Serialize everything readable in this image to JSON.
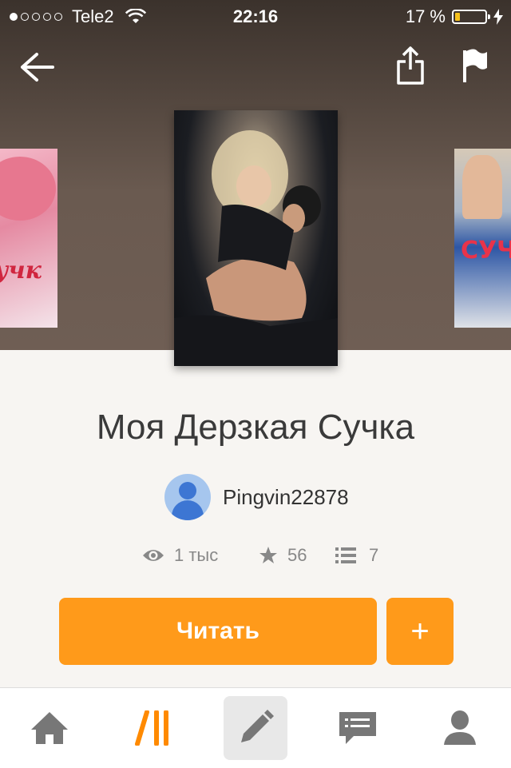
{
  "status_bar": {
    "carrier": "Tele2",
    "time": "22:16",
    "battery": "17 %",
    "battery_level": 0.17,
    "signal_dots_filled": 1
  },
  "toolbar": {
    "back_icon": "arrow-left-icon",
    "share_icon": "share-icon",
    "flag_icon": "flag-icon"
  },
  "carousel": {
    "left_cover_text": "я сучк",
    "right_cover_text": "СУЧ"
  },
  "story": {
    "title": "Моя Дерзкая Сучка",
    "author": "Pingvin22878"
  },
  "stats": {
    "views": "1 тыс",
    "votes": "56",
    "parts": "7"
  },
  "actions": {
    "read_label": "Читать",
    "add_label": "+"
  },
  "colors": {
    "accent": "#ff9a1a",
    "battery": "#f5c11d",
    "avatar": "#3d76d3"
  },
  "tabbar": {
    "items": [
      {
        "name": "home",
        "icon": "home-icon"
      },
      {
        "name": "browse",
        "icon": "wattpad-logo-icon"
      },
      {
        "name": "write",
        "icon": "pencil-icon",
        "active": true
      },
      {
        "name": "messages",
        "icon": "chat-icon"
      },
      {
        "name": "profile",
        "icon": "user-icon"
      }
    ]
  }
}
